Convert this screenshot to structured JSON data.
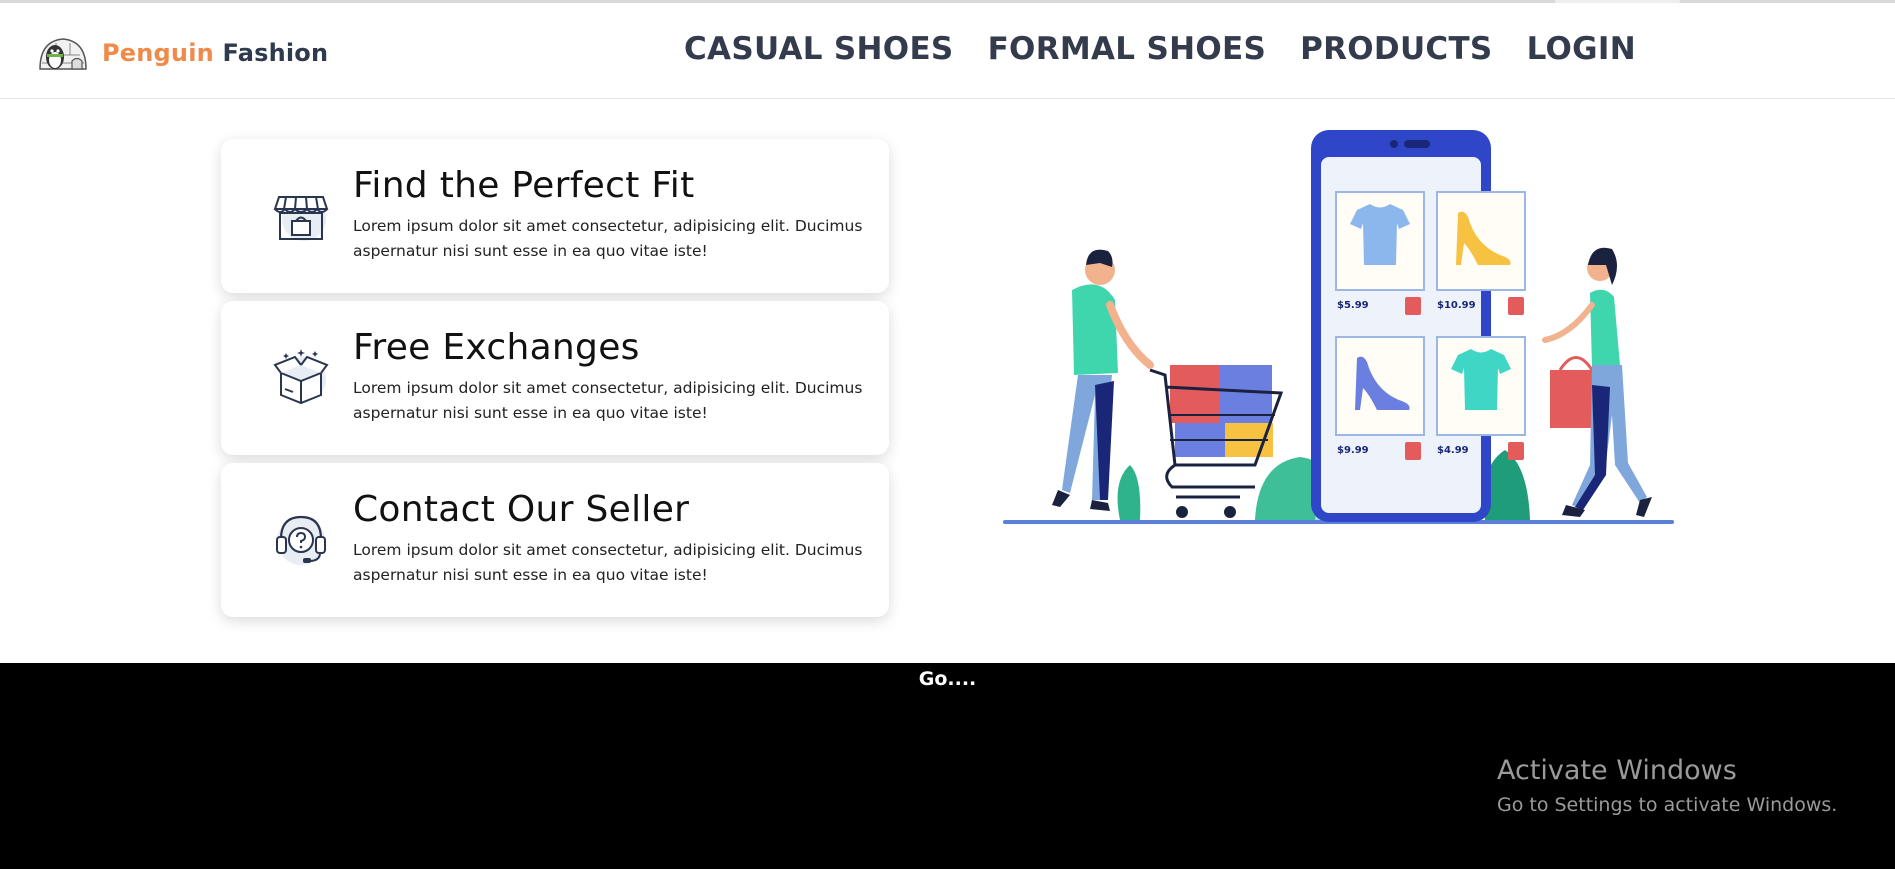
{
  "brand": {
    "name_part1": "Penguin",
    "name_part2": "Fashion",
    "logo_icon": "penguin-igloo-logo"
  },
  "nav": {
    "items": [
      {
        "label": "CASUAL SHOES"
      },
      {
        "label": "FORMAL SHOES"
      },
      {
        "label": "PRODUCTS"
      },
      {
        "label": "LOGIN"
      }
    ]
  },
  "features": [
    {
      "icon": "shop-icon",
      "title": "Find the Perfect Fit",
      "text": "Lorem ipsum dolor sit amet consectetur, adipisicing elit. Ducimus aspernatur nisi sunt esse in ea quo vitae iste!"
    },
    {
      "icon": "open-box-icon",
      "title": "Free Exchanges",
      "text": "Lorem ipsum dolor sit amet consectetur, adipisicing elit. Ducimus aspernatur nisi sunt esse in ea quo vitae iste!"
    },
    {
      "icon": "headset-support-icon",
      "title": "Contact Our Seller",
      "text": "Lorem ipsum dolor sit amet consectetur, adipisicing elit. Ducimus aspernatur nisi sunt esse in ea quo vitae iste!"
    }
  ],
  "illustration": {
    "prices": [
      "$5.99",
      "$10.99",
      "$9.99",
      "$4.99"
    ]
  },
  "footer": {
    "text": "Go...."
  },
  "watermark": {
    "title": "Activate Windows",
    "subtitle": "Go to Settings to activate Windows."
  },
  "colors": {
    "brand_orange": "#f08a4b",
    "brand_dark": "#2f3a4f",
    "nav_text": "#333b4c",
    "phone_blue": "#2f46c8",
    "footer_bg": "#000000"
  }
}
